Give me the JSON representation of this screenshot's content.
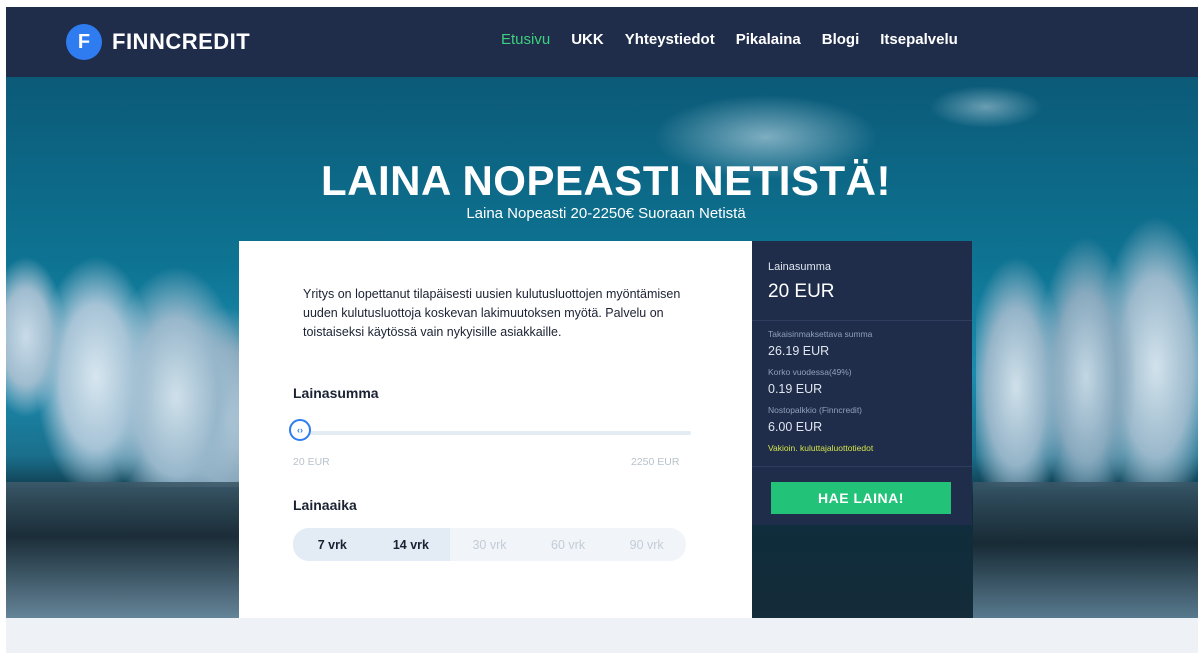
{
  "brand": {
    "logo_letter": "F",
    "name": "FINNCREDIT",
    "accent_color": "#2f7cf0"
  },
  "nav": {
    "items": [
      {
        "label": "Etusivu",
        "active": true
      },
      {
        "label": "UKK"
      },
      {
        "label": "Yhteystiedot"
      },
      {
        "label": "Pikalaina"
      },
      {
        "label": "Blogi"
      },
      {
        "label": "Itsepalvelu"
      }
    ]
  },
  "hero": {
    "title": "LAINA NOPEASTI NETISTÄ!",
    "subtitle": "Laina Nopeasti 20-2250€ Suoraan Netistä"
  },
  "form": {
    "notice": "Yritys on lopettanut tilapäisesti uusien kulutusluottojen myöntämisen uuden kulutusluottoja koskevan lakimuutoksen myötä. Palvelu on toistaiseksi käytössä vain nykyisille asiakkaille.",
    "amount_label": "Lainasumma",
    "slider": {
      "min_label": "20 EUR",
      "max_label": "2250 EUR",
      "value": 20,
      "thumb_icon": "‹›"
    },
    "term_label": "Lainaaika",
    "terms": [
      {
        "label": "7 vrk",
        "enabled": true
      },
      {
        "label": "14 vrk",
        "enabled": true
      },
      {
        "label": "30 vrk",
        "enabled": false
      },
      {
        "label": "60 vrk",
        "enabled": false
      },
      {
        "label": "90 vrk",
        "enabled": false
      }
    ]
  },
  "summary": {
    "amount_label": "Lainasumma",
    "amount_value": "20 EUR",
    "rows": [
      {
        "label": "Takaisinmaksettava summa",
        "value": "26.19 EUR"
      },
      {
        "label": "Korko vuodessa(49%)",
        "value": "0.19 EUR"
      },
      {
        "label": "Nostopalkkio (Finncredit)",
        "value": "6.00 EUR"
      }
    ],
    "link": "Vakioin. kuluttajaluottotiedot",
    "button": "HAE LAINA!",
    "button_color": "#22c279"
  }
}
